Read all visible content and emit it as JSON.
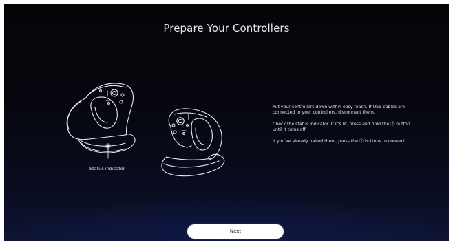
{
  "screen": {
    "title": "Prepare Your Controllers"
  },
  "illustration": {
    "status_indicator_label": "Status indicator"
  },
  "instructions": {
    "paragraphs": [
      "Put your controllers down within easy reach. If USB cables are connected to your controllers, disconnect them.",
      "Check the status indicator. If it's lit, press and hold the ⓟ button until it turns off.",
      "If you've already paired them, press the ⓟ buttons to connect."
    ]
  },
  "footer": {
    "next_label": "Next"
  },
  "colors": {
    "background_top": "#050508",
    "background_bottom_glow": "#1a2a63",
    "button_bg": "#ffffff"
  }
}
